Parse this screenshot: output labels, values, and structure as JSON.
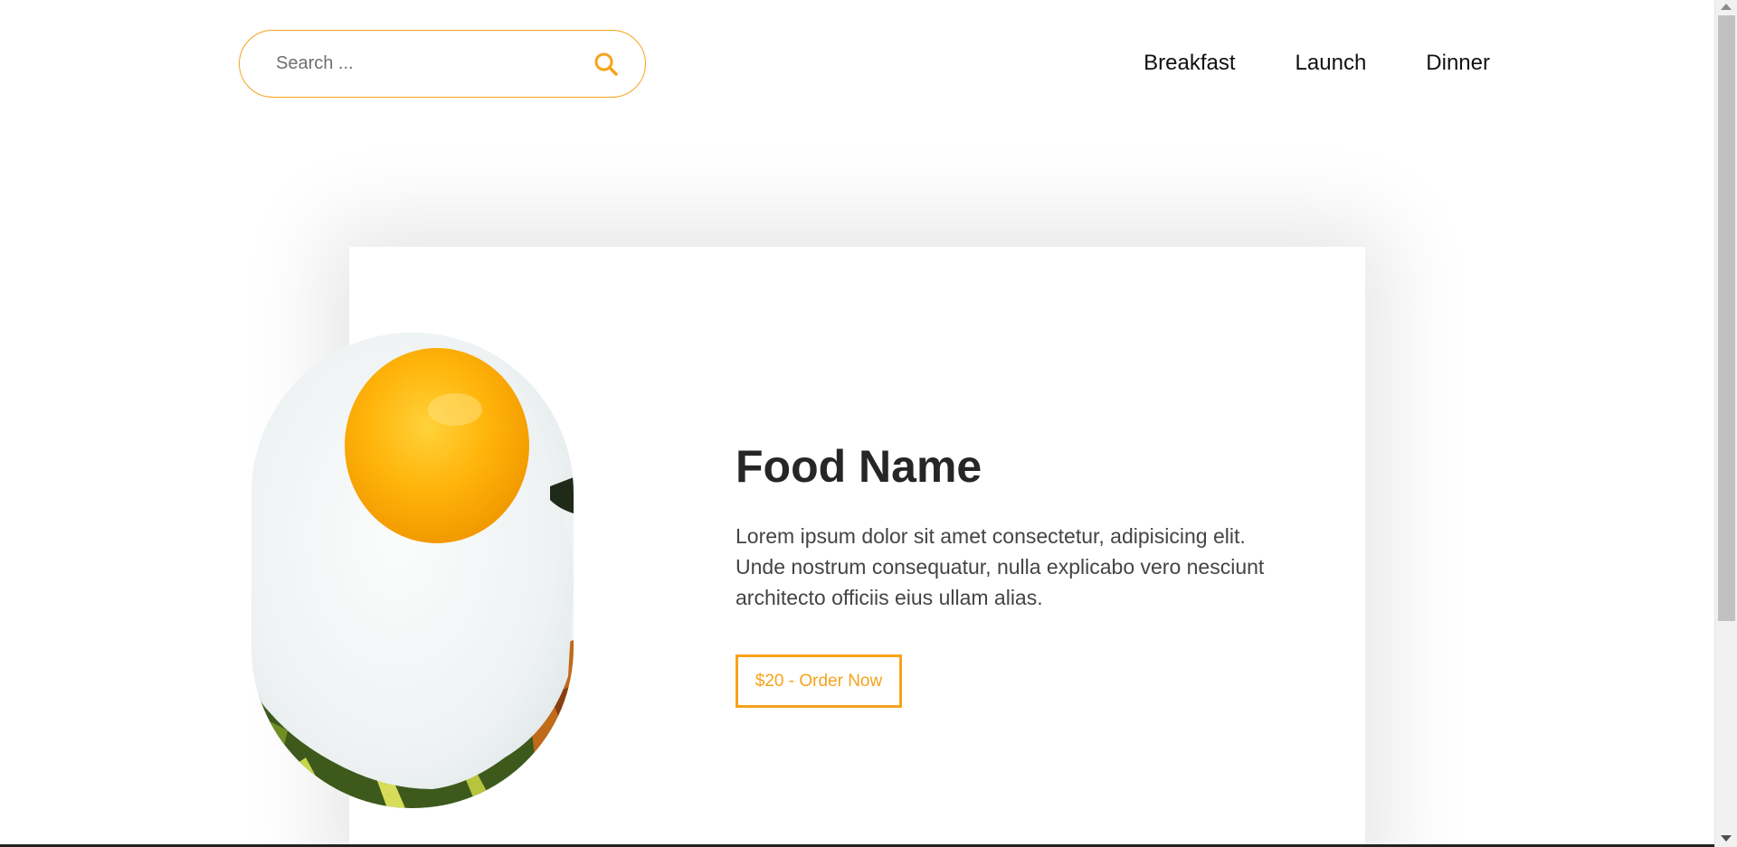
{
  "search": {
    "placeholder": "Search ...",
    "icon": "search-icon"
  },
  "nav": {
    "items": [
      {
        "label": "Breakfast"
      },
      {
        "label": "Launch"
      },
      {
        "label": "Dinner"
      }
    ]
  },
  "card": {
    "title": "Food Name",
    "description": "Lorem ipsum dolor sit amet consectetur, adipisicing elit. Unde nostrum consequatur, nulla explicabo vero nesciunt architecto officiis eius ullam alias.",
    "order_label": "$20 - Order Now"
  },
  "colors": {
    "accent": "#f7a21b",
    "title_text": "#262626",
    "body_text": "#444444"
  }
}
